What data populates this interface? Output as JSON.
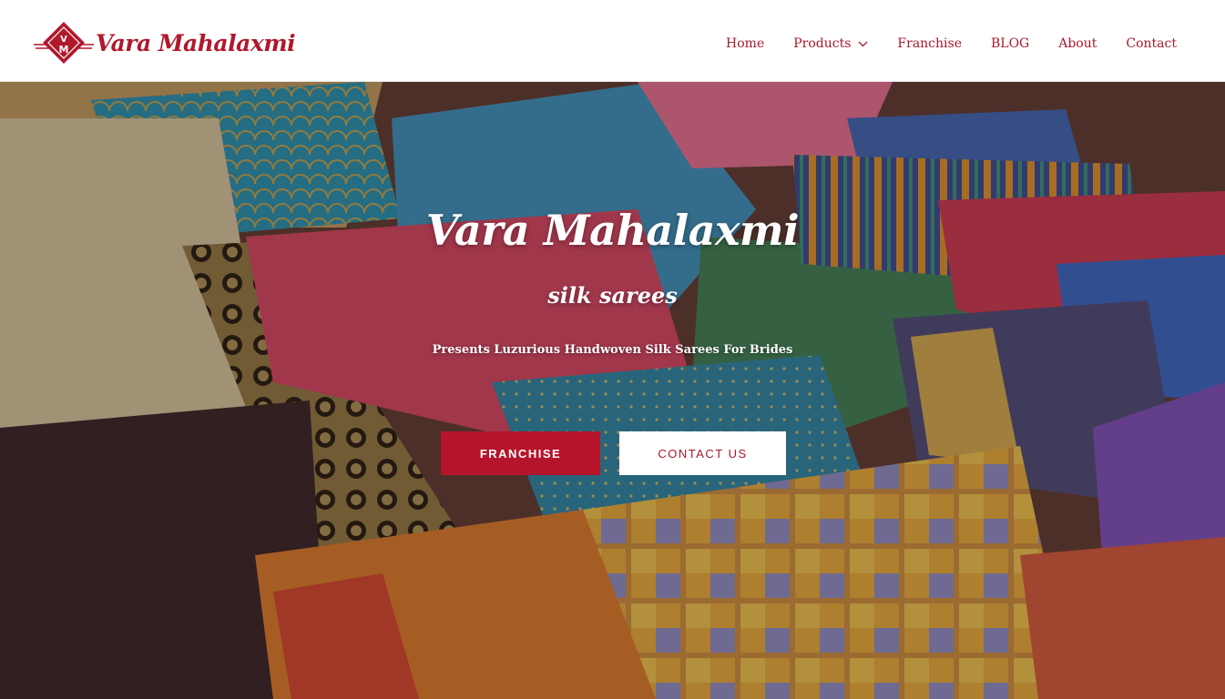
{
  "brand": {
    "name": "Vara Mahalaxmi",
    "logo_icon": "vm-diamond-logo-icon",
    "color": "#b0182c"
  },
  "nav": {
    "items": [
      {
        "label": "Home"
      },
      {
        "label": "Products",
        "has_dropdown": true,
        "icon": "chevron-down-icon"
      },
      {
        "label": "Franchise"
      },
      {
        "label": "BLOG"
      },
      {
        "label": "About"
      },
      {
        "label": "Contact"
      }
    ]
  },
  "hero": {
    "title": "Vara Mahalaxmi",
    "subtitle": "silk sarees",
    "tagline": "Presents Luzurious Handwoven Silk Sarees For Brides",
    "primary_button": "FRANCHISE",
    "secondary_button": "CONTACT US",
    "background": "stacked-silk-sarees-photo"
  },
  "colors": {
    "accent": "#b5142b",
    "nav_text": "#a8182a"
  }
}
